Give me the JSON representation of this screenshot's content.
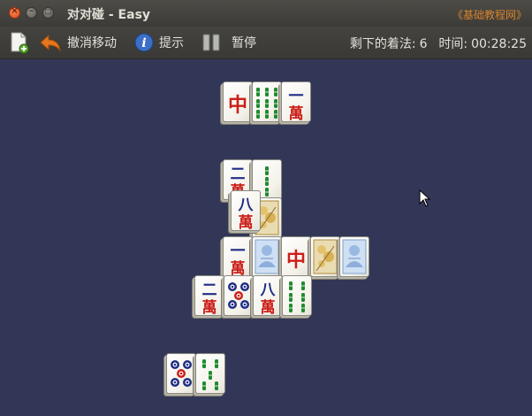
{
  "window": {
    "title": "对对碰 - Easy",
    "watermark": "《基础教程网》",
    "controls": {
      "close": "×",
      "minimize": "–",
      "maximize": "□"
    }
  },
  "toolbar": {
    "undo_label": "撤消移动",
    "hint_label": "提示",
    "pause_label": "暂停",
    "moves_label": "剩下的着法:",
    "moves_value": "6",
    "time_label": "时间:",
    "time_value": "00:28:25"
  },
  "colors": {
    "board_background": "#333757",
    "tile_face": "#f7f6f0",
    "character_red": "#cc1f1a",
    "character_blue": "#1f2d85",
    "bamboo_green": "#1f8a2e",
    "accent_orange": "#d9832a"
  },
  "tiles": [
    {
      "id": "t1",
      "suit": "dragon",
      "glyph": "中"
    },
    {
      "id": "t2",
      "suit": "bamboo",
      "rank": 9
    },
    {
      "id": "t3",
      "suit": "character",
      "numeral": "一",
      "wan": "萬"
    },
    {
      "id": "t4",
      "suit": "character",
      "numeral": "二",
      "wan": "萬"
    },
    {
      "id": "t5",
      "suit": "bamboo",
      "rank": 3
    },
    {
      "id": "t6",
      "suit": "flower",
      "glyph": "flower"
    },
    {
      "id": "t7",
      "suit": "character",
      "numeral": "八",
      "wan": "萬"
    },
    {
      "id": "t8",
      "suit": "character",
      "numeral": "一",
      "wan": "萬"
    },
    {
      "id": "t9",
      "suit": "season",
      "glyph": "season"
    },
    {
      "id": "t10",
      "suit": "dragon",
      "glyph": "中"
    },
    {
      "id": "t11",
      "suit": "flower",
      "glyph": "flower"
    },
    {
      "id": "t12",
      "suit": "season",
      "glyph": "season"
    },
    {
      "id": "t13",
      "suit": "character",
      "numeral": "二",
      "wan": "萬"
    },
    {
      "id": "t14",
      "suit": "dots",
      "rank": 5
    },
    {
      "id": "t15",
      "suit": "character",
      "numeral": "八",
      "wan": "萬"
    },
    {
      "id": "t16",
      "suit": "bamboo",
      "rank": 6
    },
    {
      "id": "t17",
      "suit": "dots",
      "rank": 5
    },
    {
      "id": "t18",
      "suit": "bamboo",
      "rank": 5
    }
  ]
}
